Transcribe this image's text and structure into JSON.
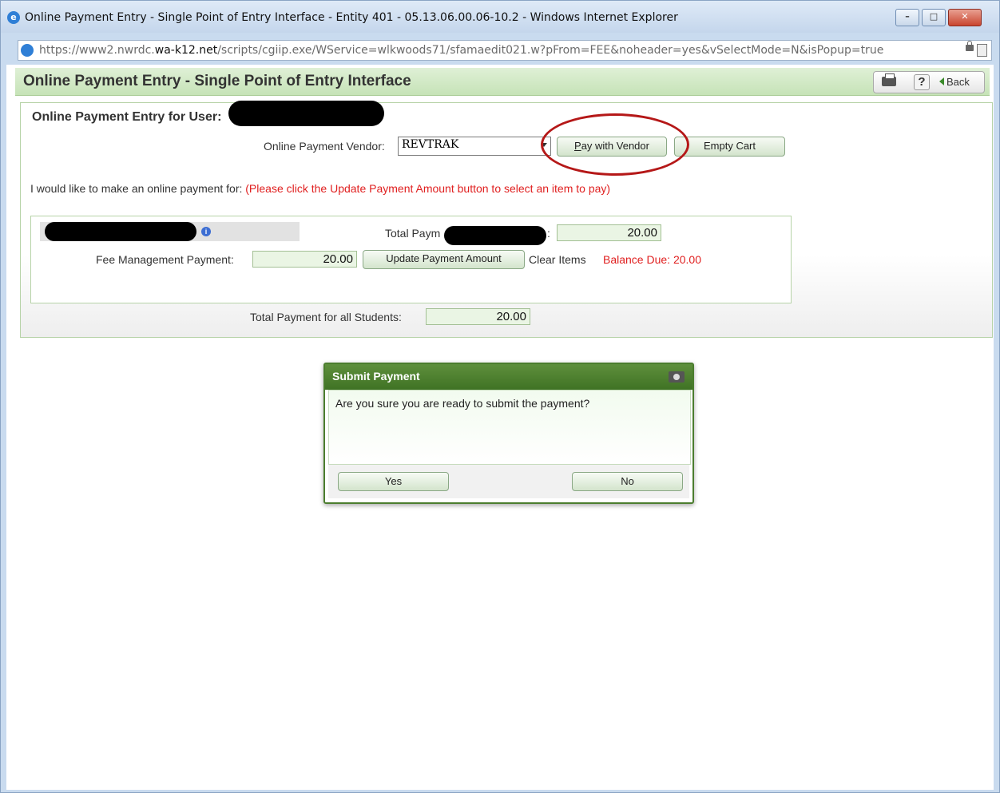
{
  "window": {
    "title": "Online Payment Entry - Single Point of Entry Interface - Entity 401 - 05.13.06.00.06-10.2 - Windows Internet Explorer",
    "controls": {
      "minimize": "–",
      "maximize": "□",
      "close": "✕"
    }
  },
  "address": {
    "prefix": "https://www2.nwrdc.",
    "domain": "wa-k12.net",
    "path": "/scripts/cgiip.exe/WService=wlkwoods71/sfamaedit021.w?pFrom=FEE&noheader=yes&vSelectMode=N&isPopup=true"
  },
  "header": {
    "title": "Online Payment Entry - Single Point of Entry Interface",
    "help": "?",
    "back": "Back"
  },
  "panel": {
    "user_label": "Online Payment Entry for User:",
    "vendor_label": "Online Payment Vendor:",
    "vendor_value": "REVTRAK",
    "pay_button_prefix": "",
    "pay_button_underline": "P",
    "pay_button_rest": "ay with Vendor",
    "empty_cart": "Empty Cart",
    "intro": "I would like to make an online payment for:",
    "intro_note": "(Please click the Update Payment Amount button to select an item to pay)",
    "info_icon": "i",
    "total_payment_label": "Total Paym",
    "total_payment_suffix": ":",
    "total_payment_value": "20.00",
    "fee_label": "Fee Management Payment:",
    "fee_value": "20.00",
    "update_button": "Update Payment Amount",
    "clear_items": "Clear Items",
    "balance_due": "Balance Due: 20.00",
    "all_students_label": "Total Payment for all Students:",
    "all_students_value": "20.00"
  },
  "dialog": {
    "title": "Submit Payment",
    "message": "Are you sure you are ready to submit the payment?",
    "yes": "Yes",
    "no": "No"
  },
  "colors": {
    "header_green": "#c6e3b7",
    "dialog_green": "#4b7d2e",
    "alert_red": "#e02020",
    "annotation_circle": "#b51818"
  }
}
